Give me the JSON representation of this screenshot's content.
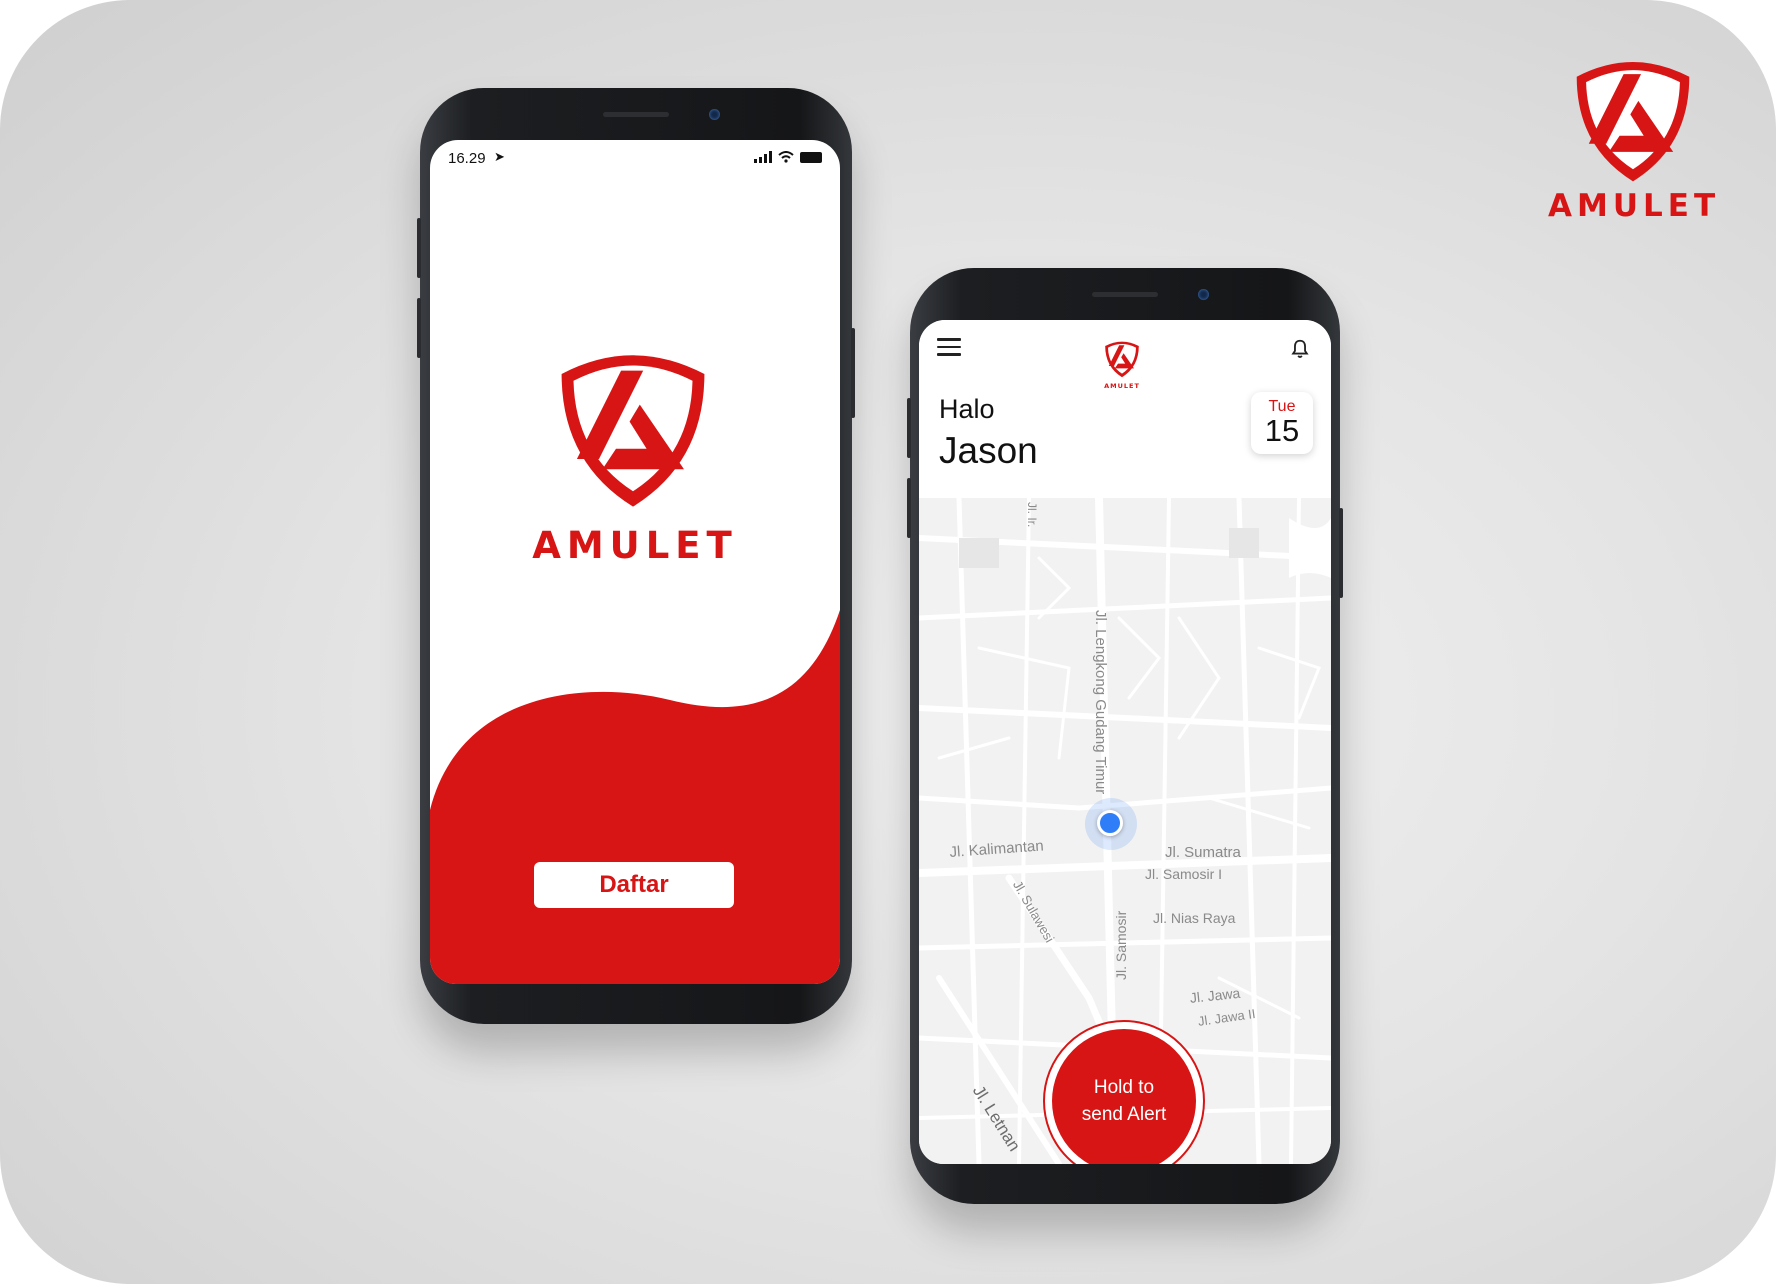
{
  "brand": {
    "name": "AMULET",
    "color": "#d81515"
  },
  "splash_screen": {
    "status_bar": {
      "time": "16.29"
    },
    "register_button_label": "Daftar"
  },
  "home_screen": {
    "greeting": "Halo",
    "user_name": "Jason",
    "date": {
      "day": "Tue",
      "number": "15"
    },
    "icons": {
      "menu": "hamburger-menu-icon",
      "notifications": "bell-icon"
    },
    "map": {
      "streets": [
        "Jl. Lengkong Gudang Timur",
        "Jl. Kalimantan",
        "Jl. Sumatra",
        "Jl. Samosir I",
        "Jl. Nias Raya",
        "Jl. Sulawesi",
        "Jl. Samosir",
        "Jl. Jawa",
        "Jl. Jawa II",
        "Jl. Letnan",
        "Jl. Ir."
      ],
      "location_marker_color": "#2f7ef7"
    },
    "alert_button_label_line1": "Hold to",
    "alert_button_label_line2": "send Alert"
  }
}
